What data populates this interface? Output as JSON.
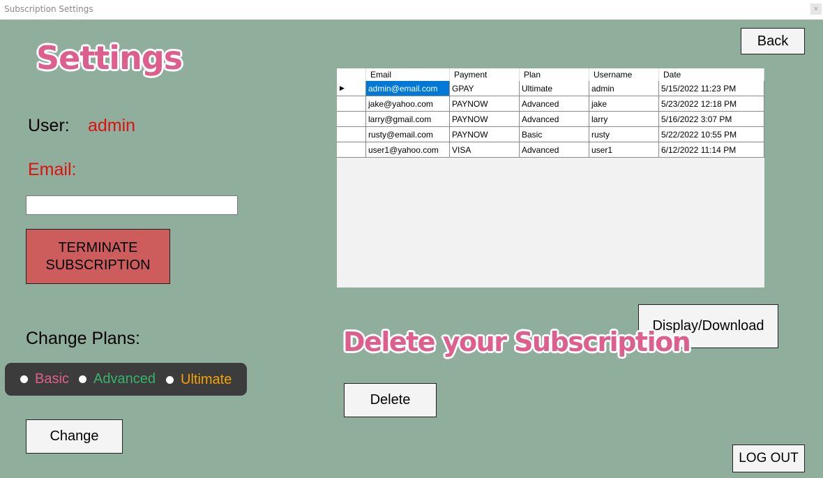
{
  "window": {
    "title": "Subscription Settings",
    "close": "×"
  },
  "page": {
    "heading": "Settings",
    "delete_heading": "Delete your Subscription"
  },
  "user": {
    "label": "User:",
    "value": "admin"
  },
  "email": {
    "label": "Email:",
    "value": ""
  },
  "buttons": {
    "back": "Back",
    "terminate": "TERMINATE SUBSCRIPTION",
    "display_download": "Display/Download",
    "delete": "Delete",
    "change": "Change",
    "logout": "LOG OUT"
  },
  "plans": {
    "label": "Change Plans:",
    "options": [
      {
        "label": "Basic",
        "color": "#e0608c"
      },
      {
        "label": "Advanced",
        "color": "#37b36a"
      },
      {
        "label": "Ultimate",
        "color": "#f5a300"
      }
    ]
  },
  "table": {
    "columns": [
      "Email",
      "Payment",
      "Plan",
      "Username",
      "Date"
    ],
    "rows": [
      [
        "admin@email.com",
        "GPAY",
        "Ultimate",
        "admin",
        "5/15/2022 11:23 PM"
      ],
      [
        "jake@yahoo.com",
        "PAYNOW",
        "Advanced",
        "jake",
        "5/23/2022 12:18 PM"
      ],
      [
        "larry@gmail.com",
        "PAYNOW",
        "Advanced",
        "larry",
        "5/16/2022 3:07 PM"
      ],
      [
        "rusty@email.com",
        "PAYNOW",
        "Basic",
        "rusty",
        "5/22/2022 10:55 PM"
      ],
      [
        "user1@yahoo.com",
        "VISA",
        "Advanced",
        "user1",
        "6/12/2022 11:14 PM"
      ]
    ],
    "current_row_marker": "▶"
  }
}
